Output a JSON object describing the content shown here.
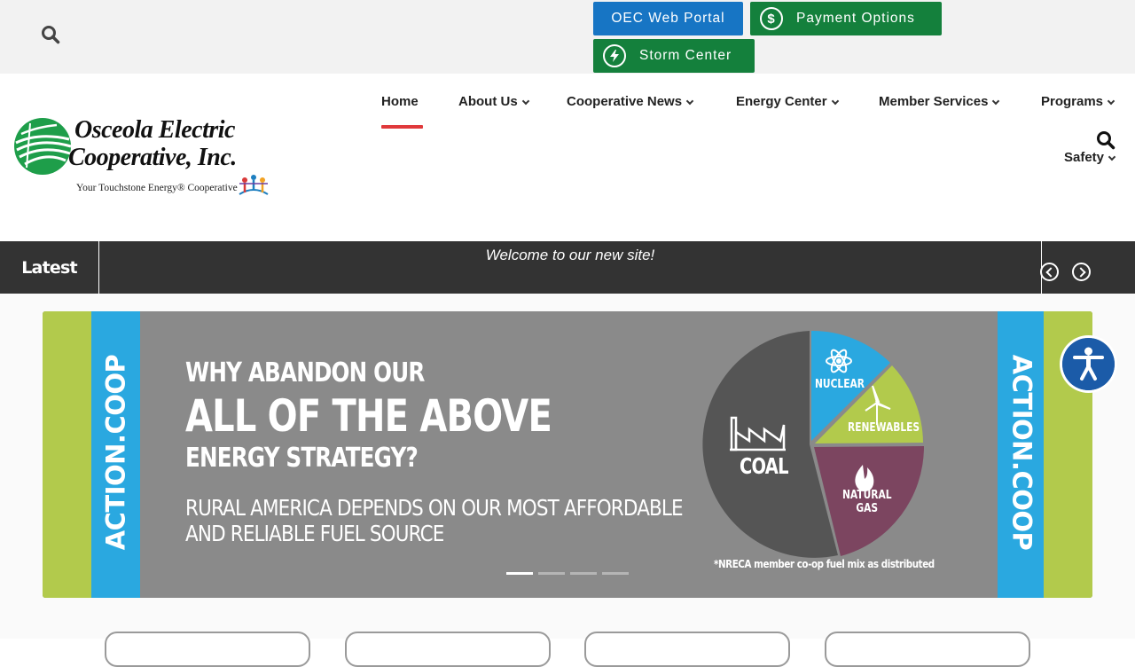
{
  "top_bar": {
    "search_icon": "search-icon",
    "web_portal_label": "OEC Web Portal",
    "payment_label": "Payment Options",
    "payment_icon": "dollar-circle-icon",
    "storm_label": "Storm Center",
    "storm_icon": "lightning-circle-icon",
    "colors": {
      "blue": "#1775c4",
      "green": "#14803c"
    }
  },
  "header": {
    "logo": {
      "name_line1": "Osceola Electric",
      "name_line2": "Cooperative, Inc.",
      "tagline": "Your Touchstone Energy® Cooperative"
    },
    "nav": [
      {
        "label": "Home",
        "active": true,
        "has_dropdown": false
      },
      {
        "label": "About Us",
        "has_dropdown": true
      },
      {
        "label": "Cooperative News",
        "has_dropdown": true
      },
      {
        "label": "Energy Center",
        "has_dropdown": true
      },
      {
        "label": "Member Services",
        "has_dropdown": true
      },
      {
        "label": "Programs",
        "has_dropdown": true
      },
      {
        "label": "Safety",
        "has_dropdown": true
      }
    ],
    "accent_color": "#e0393b"
  },
  "ticker": {
    "label": "Latest",
    "text": "Welcome to our new site!"
  },
  "slider": {
    "side_text": "ACTION.COOP",
    "headline_1": "WHY ABANDON OUR",
    "headline_2": "ALL OF THE ABOVE",
    "headline_3": "ENERGY STRATEGY?",
    "subline_1": "RURAL AMERICA DEPENDS ON OUR MOST AFFORDABLE",
    "subline_2": "AND RELIABLE FUEL SOURCE",
    "pie": {
      "coal": "COAL",
      "nuclear": "NUCLEAR",
      "renewables": "RENEWABLES",
      "natural_gas_1": "NATURAL",
      "natural_gas_2": "GAS"
    },
    "footnote": "*NRECA member co-op fuel mix as distributed",
    "slide_count": 4,
    "active_slide": 1,
    "colors": {
      "green": "#b2ca4c",
      "blue": "#2aa8e0",
      "gray": "#8a8a8a"
    }
  },
  "accessibility": {
    "icon": "accessibility-person-icon",
    "color": "#1b5ba8"
  }
}
